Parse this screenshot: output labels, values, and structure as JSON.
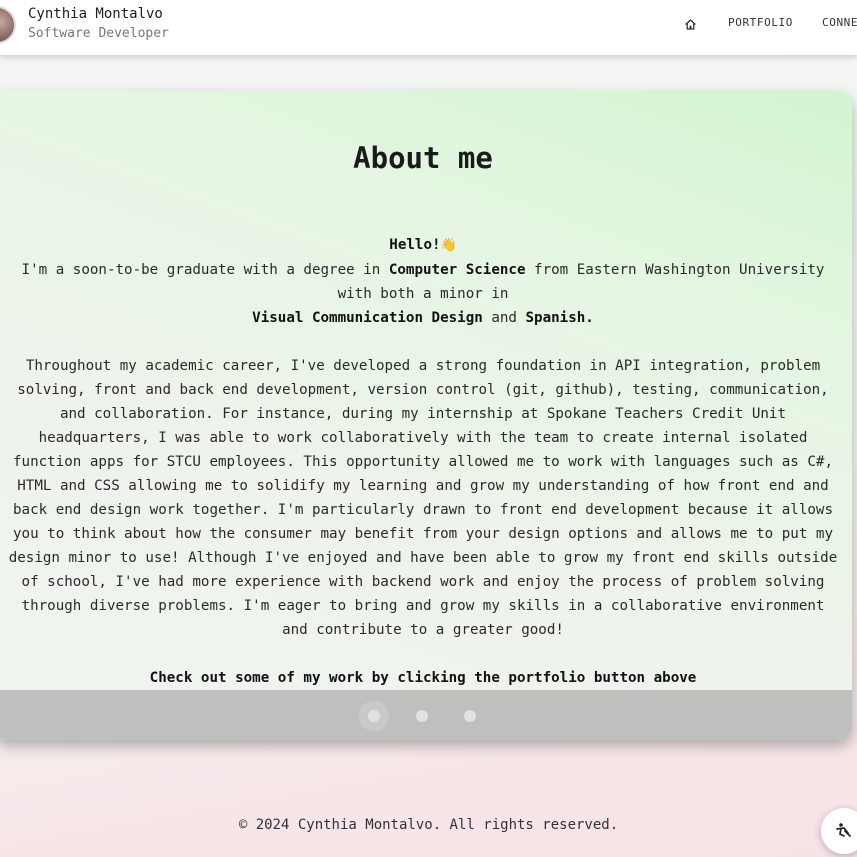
{
  "header": {
    "name": "Cynthia Montalvo",
    "role": "Software Developer",
    "nav": {
      "home_icon": "home-icon",
      "portfolio": "PORTFOLIO",
      "connect": "CONNE"
    }
  },
  "about": {
    "title": "About me",
    "greeting": "Hello!",
    "greeting_emoji": "👋",
    "intro_1": "I'm a soon-to-be graduate with a degree in ",
    "degree": "Computer Science",
    "intro_2": " from Eastern Washington University with both a minor in ",
    "minor_1": "Visual Communication Design",
    "and": " and ",
    "minor_2": "Spanish.",
    "paragraph": "Throughout my academic career, I've developed a strong foundation in API integration, problem solving, front and back end development, version control (git, github), testing, communication, and collaboration. For instance, during my internship at Spokane Teachers Credit Unit headquarters, I was able to work collaboratively with the team to create internal isolated function apps for STCU employees. This opportunity allowed me to work with languages such as C#, HTML and CSS allowing me to solidify my learning and grow my understanding of how front end and back end design work together. I'm particularly drawn to front end development because it allows you to think about how the consumer may benefit from your design options and allows me to put my design minor to use! Although I've enjoyed and have been able to grow my front end skills outside of school, I've had more experience with backend work and enjoy the process of problem solving through diverse problems. I'm eager to bring and grow my skills in a collaborative environment and contribute to a greater good!",
    "cta": "Check out some of my work by clicking the portfolio button above"
  },
  "carousel": {
    "slides": 3,
    "active_index": 0
  },
  "footer": {
    "copyright": "© 2024 Cynthia Montalvo. All rights reserved."
  },
  "fab": {
    "icon": "accessibility-icon"
  }
}
